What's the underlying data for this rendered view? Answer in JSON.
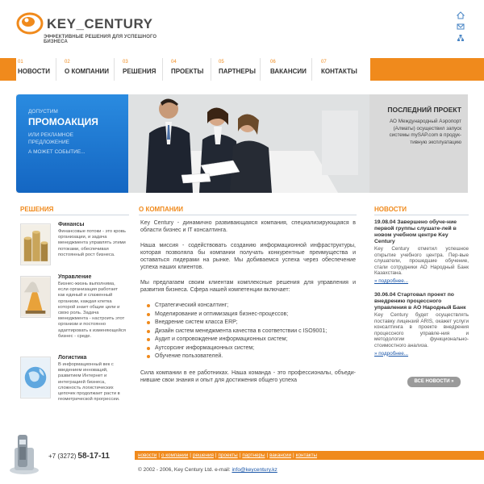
{
  "brand": {
    "name": "KEY_CENTURY",
    "tagline": "ЭФФЕКТИВНЫЕ РЕШЕНИЯ ДЛЯ УСПЕШНОГО БИЗНЕСА",
    "accent_color": "#f08a1c",
    "blue_color": "#1466c2"
  },
  "top_icons": [
    "home-icon",
    "mail-icon",
    "sitemap-icon"
  ],
  "nav": {
    "items": [
      {
        "num": "01",
        "label": "НОВОСТИ"
      },
      {
        "num": "02",
        "label": "О КОМПАНИИ"
      },
      {
        "num": "03",
        "label": "РЕШЕНИЯ"
      },
      {
        "num": "04",
        "label": "ПРОЕКТЫ"
      },
      {
        "num": "05",
        "label": "ПАРТНЕРЫ"
      },
      {
        "num": "06",
        "label": "ВАКАНСИИ"
      },
      {
        "num": "07",
        "label": "КОНТАКТЫ"
      }
    ]
  },
  "promo": {
    "line1": "ДОПУСТИМ",
    "line2": "ПРОМОАКЦИЯ",
    "line3": "ИЛИ РЕКЛАМНОЕ ПРЕДЛОЖЕНИЕ",
    "line4": "А МОЖЕТ СОБЫТИЕ..."
  },
  "last_project": {
    "title": "ПОСЛЕДНИЙ ПРОЕКТ",
    "text": "АО Международный Аэропорт (Алматы) осуществил запуск системы mySAP.com в продук-тивную эксплуатацию"
  },
  "solutions": {
    "heading": "РЕШЕНИЯ",
    "items": [
      {
        "title": "Финансы",
        "text": "Финансовые потоки - это кровь организации, и задача менеджмента управлять этими потоками, обеспечивая постоянный рост бизнеса."
      },
      {
        "title": "Управление",
        "text": "Бизнес-жизнь выполнима, если организация работает как единый и слаженный организм, каждая клетка которой знает общие цели и свою роль. Задача менеджмента - настроить этот организм и постоянно адаптировать к изменяющейся бизнес - среде."
      },
      {
        "title": "Логистика",
        "text": "В информационный век с введением инноваций, развитием Интернет и интеграцией бизнеса, сложность логистических цепочек продолжает расти в геометрической прогрессии."
      }
    ]
  },
  "about": {
    "heading": "О КОМПАНИИ",
    "p1": "Key Century - динамично развивающаяся компания, специализирующаяся в области бизнес и IT консалтинга.",
    "p2": "Наша миссия - содействовать созданию информационной инфраструктуры, которая позволяла бы компании получать конкурентные преимущества и оставаться лидерами на рынке. Мы добиваемся успеха через обеспечение успеха наших клиентов.",
    "p3": "Мы предлагаем своим клиентам комплексные решения для управления и развития бизнеса. Сфера нашей компетенции включает:",
    "list": [
      "Стратегический консалтинг;",
      "Моделирование и оптимизация бизнес-процессов;",
      "Внедрение систем класса ERP;",
      "Дизайн систем менеджмента качества в соответствии с ISO9001;",
      "Аудит и сопровождение информационных систем;",
      "Аутсорсинг информационных систем;",
      "Обучение пользователей."
    ],
    "p4": "Сила компании в ее работниках. Наша команда - это профессионалы, объеди-нившие свои знания и опыт для достижения общего успеха"
  },
  "news": {
    "heading": "НОВОСТИ",
    "items": [
      {
        "title": "19.08.04 Завершено обуче-ние первой группы слушате-лей в новом учебном центре Key Century",
        "text": "Key Century отметил успешное открытие учебного центра. Пер-вые слушатели, прошедшие обучение, стали сотрудники АО Народный Банк Казахстана.",
        "more": "» подробнее..."
      },
      {
        "title": "30.06.04 Стартовал проект по внедрению процессного управления в АО Народный Банк",
        "text": "Key Century будет осуществлять поставку лицензий ARIS, окажет услуги консалтинга в проекте внедрения процессного управле-ния и методологии функционально-стоимостного анализа.",
        "more": "» подробнее..."
      }
    ],
    "all_button": "ВСЕ НОВОСТИ »"
  },
  "footer": {
    "phone_code": "+7 (3272)",
    "phone_number": "58-17-11",
    "links": [
      "новости",
      "о компании",
      "решения",
      "проекты",
      "партнеры",
      "вакансии",
      "контакты"
    ],
    "copyright": "© 2002 - 2006, Key Century Ltd. e-mail:",
    "email": "info@keycentury.kz"
  }
}
